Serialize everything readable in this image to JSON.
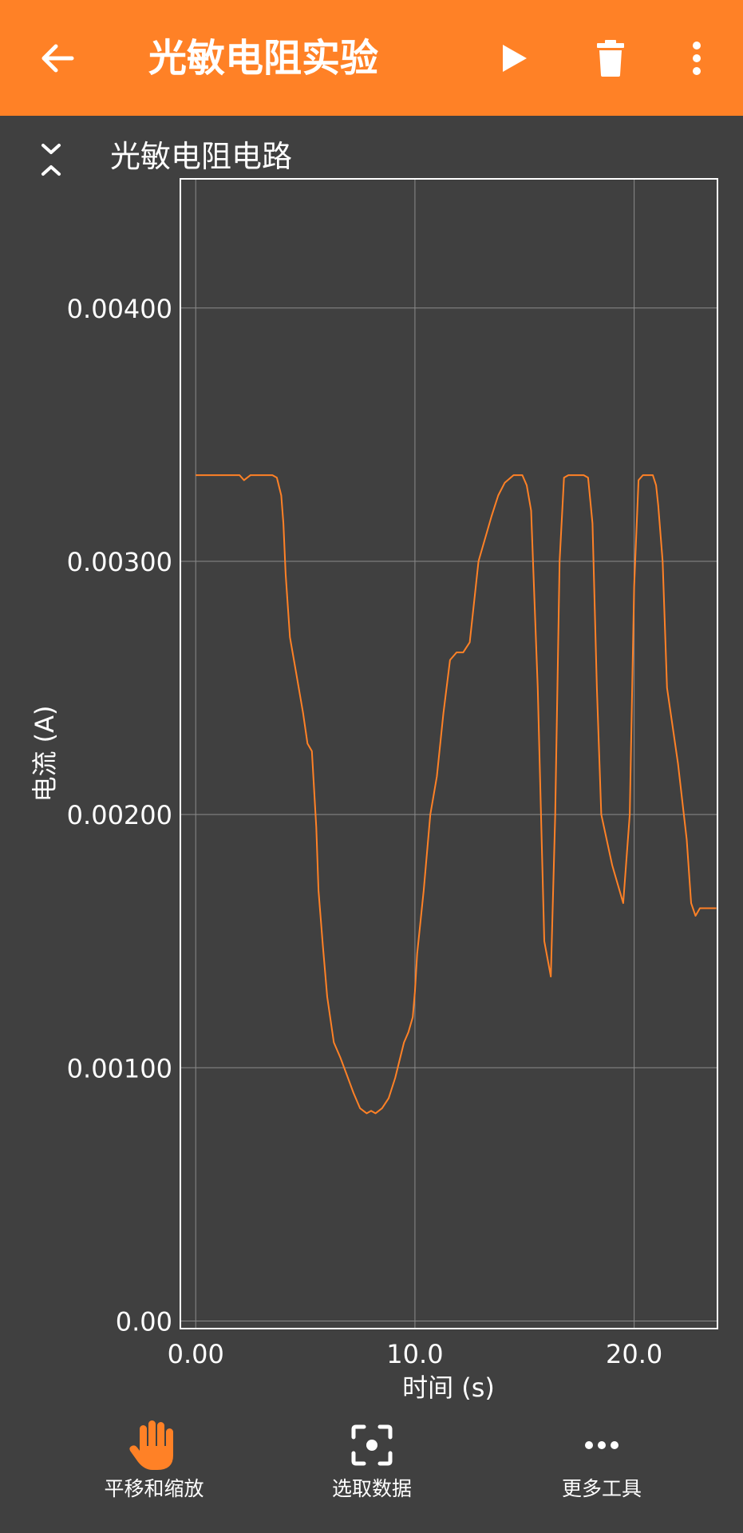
{
  "app_bar": {
    "title": "光敏电阻实验",
    "back_icon": "arrow-left-icon",
    "play_icon": "play-icon",
    "delete_icon": "trash-icon",
    "more_icon": "more-vertical-icon",
    "background_color": "#ff8126"
  },
  "chart_header": {
    "title": "光敏电阻电路",
    "collapse_icon": "collapse-chevrons-icon"
  },
  "chart_data": {
    "type": "line",
    "title": "光敏电阻电路",
    "xlabel": "时间 (s)",
    "ylabel": "电流 (A)",
    "xlim": [
      -0.7,
      23.8
    ],
    "ylim": [
      -3e-05,
      0.00451
    ],
    "x_ticks": [
      "0.00",
      "10.0",
      "20.0"
    ],
    "x_tick_values": [
      0,
      10,
      20
    ],
    "y_ticks": [
      "0.00",
      "0.00100",
      "0.00200",
      "0.00300",
      "0.00400"
    ],
    "y_tick_values": [
      0,
      0.001,
      0.002,
      0.003,
      0.004
    ],
    "grid": true,
    "line_color": "#ff8126",
    "series": [
      {
        "x": [
          0.0,
          1.0,
          2.0,
          2.2,
          2.5,
          3.0,
          3.5,
          3.7,
          3.9,
          4.0,
          4.1,
          4.3,
          4.6,
          4.9,
          5.1,
          5.3,
          5.5,
          5.6,
          5.8,
          6.0,
          6.3,
          6.6,
          6.9,
          7.2,
          7.5,
          7.8,
          8.0,
          8.2,
          8.5,
          8.8,
          9.1,
          9.3,
          9.5,
          9.7,
          9.9,
          10.0,
          10.1,
          10.4,
          10.7,
          11.0,
          11.3,
          11.6,
          11.9,
          12.2,
          12.5,
          12.9,
          13.3,
          13.5,
          13.8,
          14.1,
          14.5,
          14.9,
          15.1,
          15.3,
          15.6,
          15.9,
          16.2,
          16.4,
          16.6,
          16.8,
          17.0,
          17.2,
          17.4,
          17.55,
          17.7,
          17.9,
          18.1,
          18.3,
          18.5,
          19.0,
          19.5,
          19.8,
          20.0,
          20.2,
          20.4,
          20.55,
          20.7,
          20.85,
          21.0,
          21.1,
          21.3,
          21.5,
          22.0,
          22.4,
          22.6,
          22.8,
          23.0,
          23.2,
          23.4,
          23.6,
          23.75
        ],
        "y": [
          0.00334,
          0.00334,
          0.00334,
          0.00332,
          0.00334,
          0.00334,
          0.00334,
          0.00333,
          0.00326,
          0.00315,
          0.00295,
          0.0027,
          0.00255,
          0.0024,
          0.00228,
          0.00225,
          0.00195,
          0.0017,
          0.00148,
          0.00128,
          0.0011,
          0.00104,
          0.00097,
          0.0009,
          0.00084,
          0.00082,
          0.00083,
          0.00082,
          0.00084,
          0.00088,
          0.00096,
          0.00103,
          0.0011,
          0.00114,
          0.0012,
          0.0013,
          0.00145,
          0.0017,
          0.002,
          0.00215,
          0.0024,
          0.00261,
          0.00264,
          0.00264,
          0.00268,
          0.003,
          0.00312,
          0.00318,
          0.00326,
          0.00331,
          0.00334,
          0.00334,
          0.0033,
          0.0032,
          0.0025,
          0.0015,
          0.00136,
          0.002,
          0.003,
          0.00333,
          0.00334,
          0.00334,
          0.00334,
          0.00334,
          0.00334,
          0.00333,
          0.00315,
          0.0025,
          0.002,
          0.0018,
          0.00165,
          0.002,
          0.0029,
          0.00332,
          0.00334,
          0.00334,
          0.00334,
          0.00334,
          0.0033,
          0.00322,
          0.003,
          0.0025,
          0.0022,
          0.0019,
          0.00165,
          0.0016,
          0.00163,
          0.00163,
          0.00163,
          0.00163,
          0.00163
        ]
      }
    ]
  },
  "toolbar": {
    "pan_zoom_label": "平移和缩放",
    "select_data_label": "选取数据",
    "more_tools_label": "更多工具",
    "pan_zoom_icon": "hand-icon",
    "select_data_icon": "focus-select-icon",
    "more_tools_icon": "more-horizontal-icon",
    "active_color": "#ff8126"
  }
}
